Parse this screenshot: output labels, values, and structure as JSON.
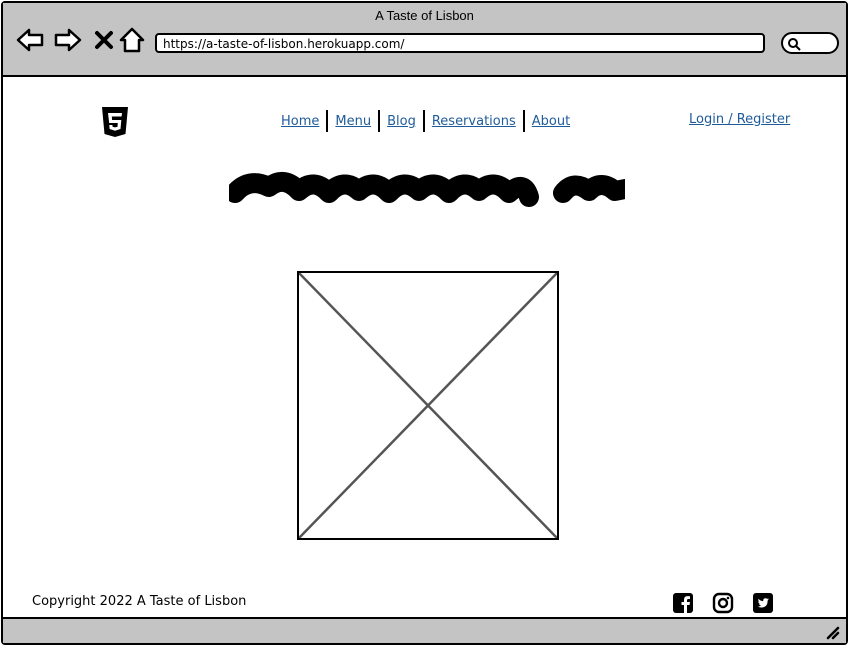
{
  "window": {
    "title": "A Taste of Lisbon"
  },
  "browser": {
    "url": "https://a-taste-of-lisbon.herokuapp.com/",
    "back_icon": "arrow-left-icon",
    "forward_icon": "arrow-right-icon",
    "close_icon": "close-icon",
    "home_icon": "home-icon",
    "search_icon": "search-icon"
  },
  "header": {
    "logo_icon": "html5-logo-icon",
    "nav": [
      {
        "label": "Home"
      },
      {
        "label": "Menu"
      },
      {
        "label": "Blog"
      },
      {
        "label": "Reservations"
      },
      {
        "label": "About"
      }
    ],
    "login_label": "Login / Register"
  },
  "main": {
    "heading_placeholder": "scribble",
    "image_placeholder": "image-placeholder"
  },
  "footer": {
    "copyright": "Copyright 2022 A Taste of Lisbon",
    "social": [
      "facebook-icon",
      "instagram-icon",
      "twitter-icon"
    ]
  }
}
